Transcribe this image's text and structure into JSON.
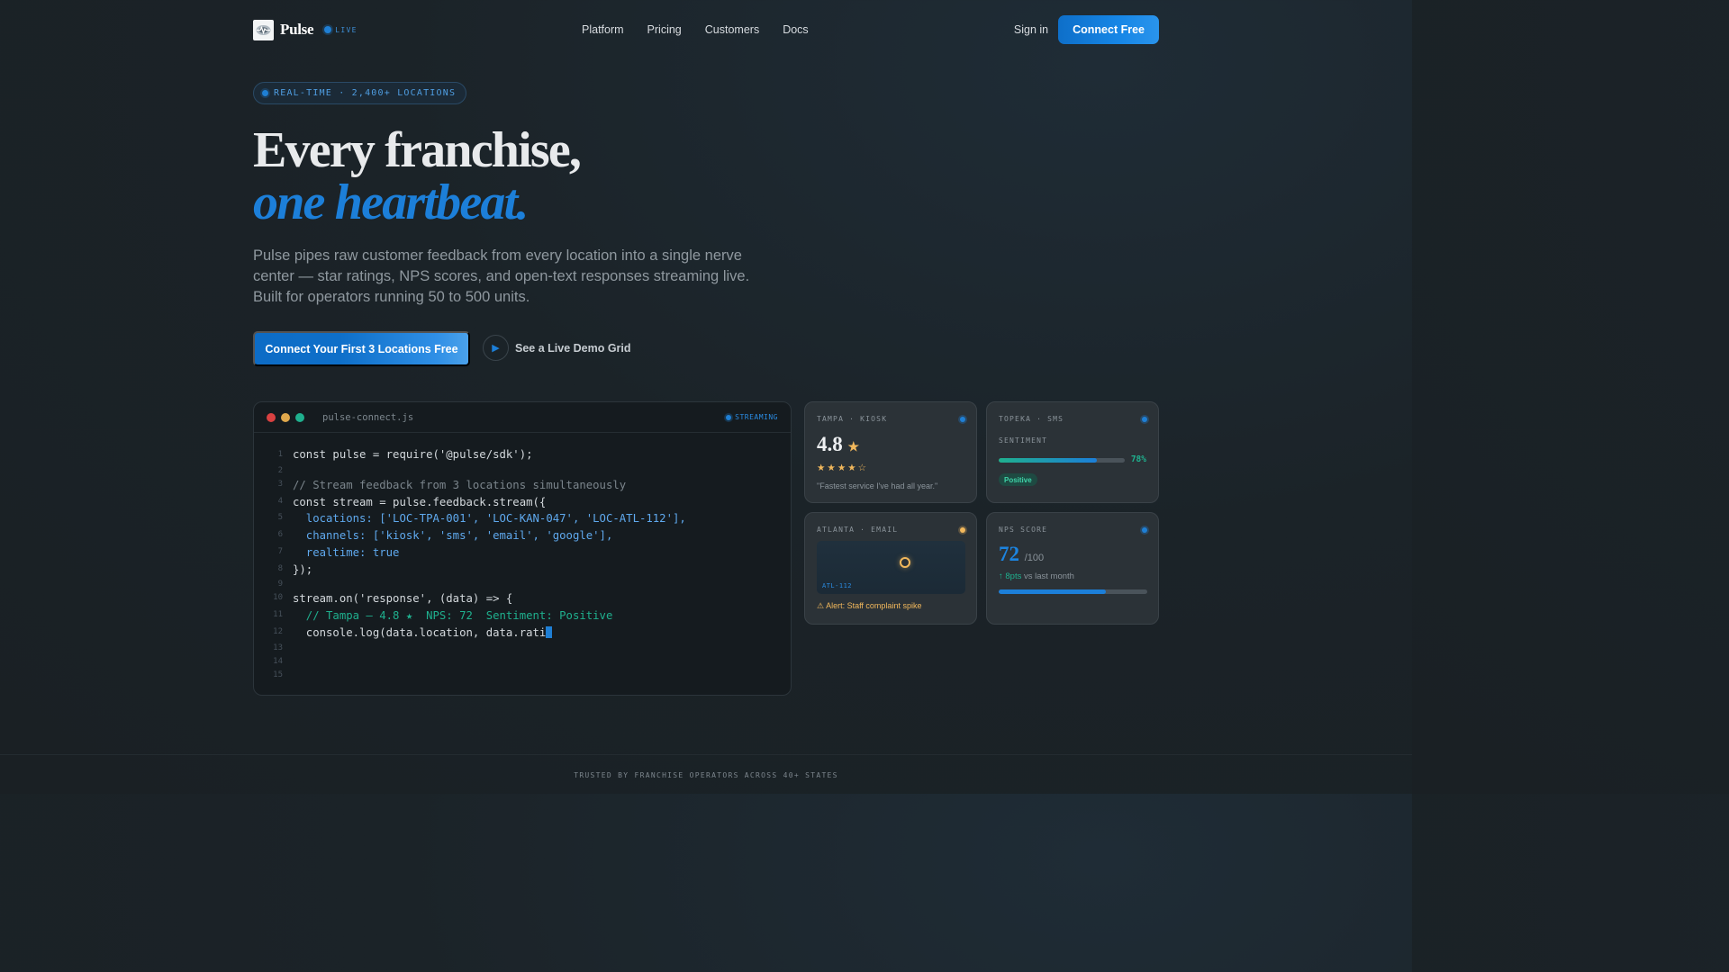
{
  "nav": {
    "brand": "Pulse",
    "live": "LIVE",
    "links": [
      "Platform",
      "Pricing",
      "Customers",
      "Docs"
    ],
    "signin": "Sign in",
    "cta": "Connect Free"
  },
  "hero": {
    "pill": "REAL-TIME · 2,400+ LOCATIONS",
    "headline_1": "Every franchise,",
    "headline_2": "one heartbeat.",
    "subhead": "Pulse pipes raw customer feedback from every location into a single nerve center — star ratings, NPS scores, and open-text responses streaming live. Built for operators running 50 to 500 units.",
    "cta_primary": "Connect Your First 3 Locations Free",
    "cta_secondary": "See a Live Demo Grid"
  },
  "code": {
    "filename": "pulse-connect.js",
    "status": "STREAMING",
    "line_numbers": [
      "1",
      "2",
      "3",
      "4",
      "5",
      "6",
      "7",
      "8",
      "9",
      "10",
      "11",
      "12",
      "13",
      "14",
      "15"
    ],
    "lines": [
      "const pulse = require('@pulse/sdk');",
      "",
      "// Stream feedback from 3 locations simultaneously",
      "const stream = pulse.feedback.stream({",
      "  locations: ['LOC-TPA-001', 'LOC-KAN-047', 'LOC-ATL-112'],",
      "  channels: ['kiosk', 'sms', 'email', 'google'],",
      "  realtime: true",
      "});",
      "",
      "stream.on('response', (data) => {",
      "  // Tampa — 4.8 ★  NPS: 72  Sentiment: Positive",
      "  console.log(data.location, data.rati",
      "",
      "",
      ""
    ]
  },
  "cards": {
    "tampa": {
      "label": "TAMPA · KIOSK",
      "rating": "4.8",
      "star": "★",
      "stars": "★★★★☆",
      "quote": "\"Fastest service I've had all year.\""
    },
    "topeka": {
      "label": "TOPEKA · SMS",
      "sentiment_label": "SENTIMENT",
      "percent": "78%",
      "percent_value": 78,
      "badge": "Positive"
    },
    "atlanta": {
      "label": "ATLANTA · EMAIL",
      "map_label": "ATL-112",
      "alert": "⚠ Alert: Staff complaint spike"
    },
    "nps": {
      "label": "NPS SCORE",
      "score": "72",
      "out_of": "/100",
      "delta": "↑ 8pts",
      "delta_suffix": " vs last month",
      "score_value": 72
    }
  },
  "footer": {
    "text": "TRUSTED BY FRANCHISE OPERATORS ACROSS 40+ STATES"
  },
  "colors": {
    "accent": "#1c7fd9",
    "green": "#1fb08e",
    "amber": "#f2b85c",
    "background": "#1b2328"
  },
  "icons": [
    "logo-icon",
    "live-dot-icon",
    "play-icon",
    "star-icon",
    "alert-icon",
    "location-marker-icon"
  ]
}
